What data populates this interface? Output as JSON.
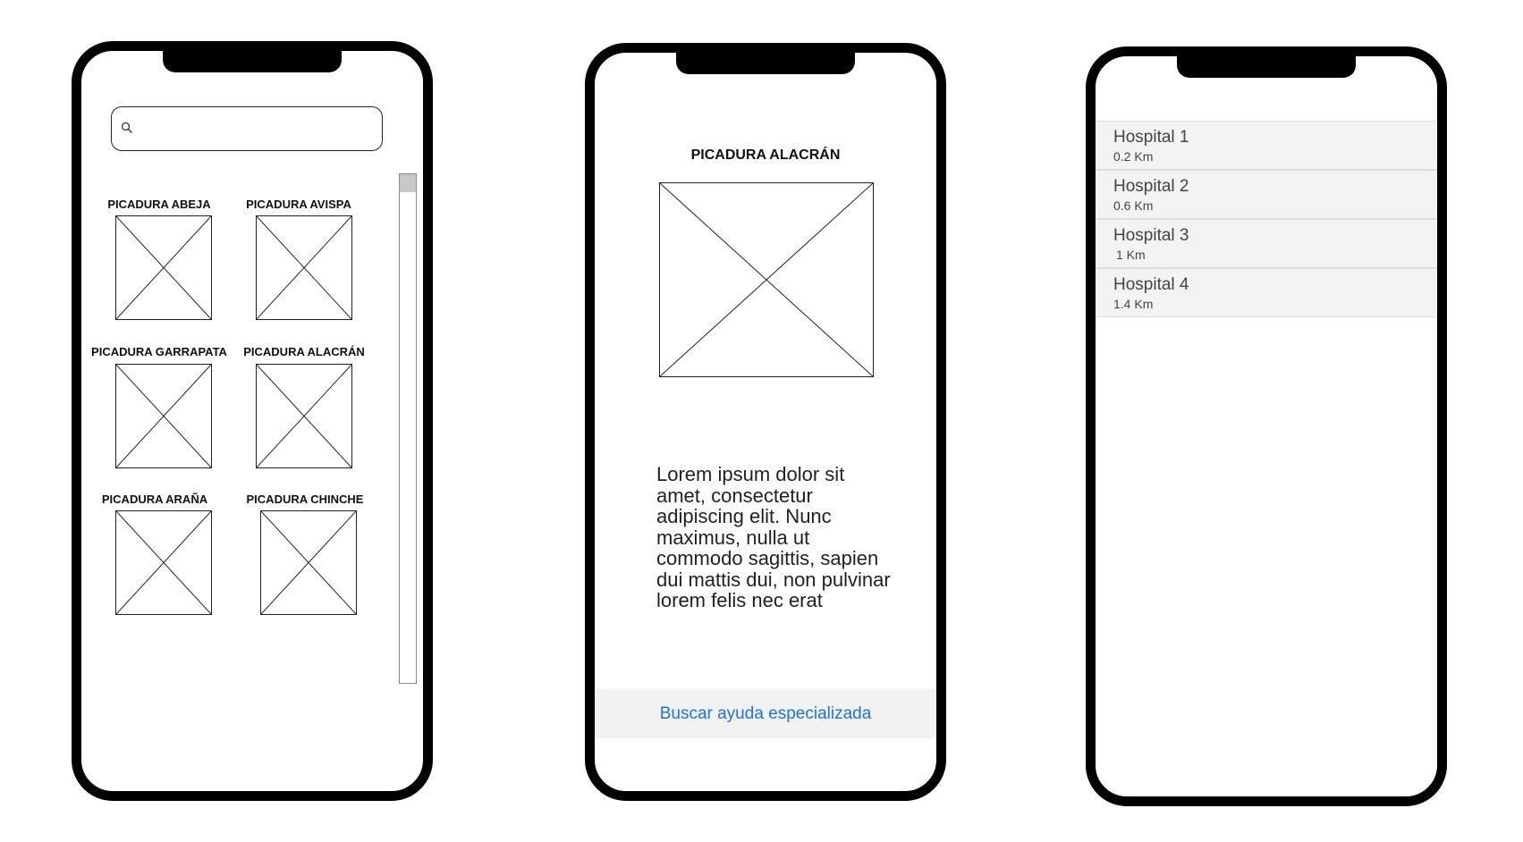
{
  "screen_list": {
    "search": {
      "placeholder": "",
      "value": ""
    },
    "items": [
      {
        "label": "PICADURA ABEJA"
      },
      {
        "label": "PICADURA AVISPA"
      },
      {
        "label": "PICADURA GARRAPATA"
      },
      {
        "label": "PICADURA ALACRÁN"
      },
      {
        "label": "PICADURA ARAÑA"
      },
      {
        "label": "PICADURA CHINCHE"
      }
    ]
  },
  "screen_detail": {
    "title": "PICADURA ALACRÁN",
    "body": "Lorem ipsum dolor sit amet, consectetur adipiscing elit. Nunc maximus, nulla ut commodo sagittis, sapien dui mattis dui, non pulvinar lorem felis nec erat",
    "help_button": "Buscar ayuda especializada"
  },
  "screen_hospitals": {
    "items": [
      {
        "name": "Hospital 1",
        "distance": "0.2 Km"
      },
      {
        "name": "Hospital 2",
        "distance": "0.6 Km"
      },
      {
        "name": "Hospital 3",
        "distance": "1 Km"
      },
      {
        "name": "Hospital 4",
        "distance": "1.4 Km"
      }
    ]
  },
  "colors": {
    "frame": "#000000",
    "link": "#1a73e8",
    "list_bg": "#f3f3f3"
  }
}
